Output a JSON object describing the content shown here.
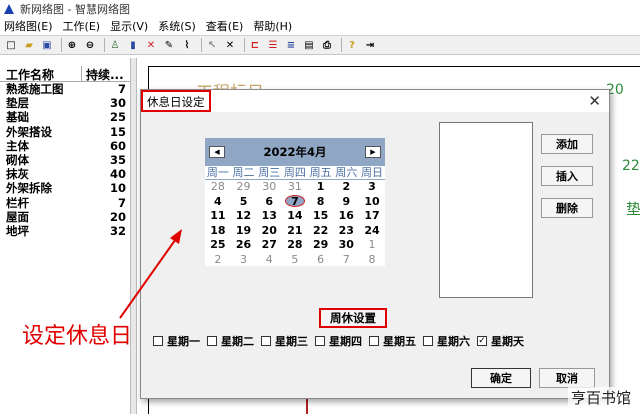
{
  "window": {
    "title": "新网络图 - 智慧网络图"
  },
  "menu": [
    "网络图(E)",
    "工作(E)",
    "显示(V)",
    "系统(S)",
    "查看(E)",
    "帮助(H)"
  ],
  "toolbar": {
    "icons": [
      "new-icon",
      "open-icon",
      "save-icon",
      "zoom-in-icon",
      "zoom-out-icon",
      "person-icon",
      "chart-icon",
      "delete-icon",
      "edit-icon",
      "link-icon",
      "cursor-icon",
      "tool-icon",
      "flow-icon",
      "bars-icon",
      "lines-icon",
      "preview-icon",
      "print-icon",
      "help-icon",
      "exit-icon"
    ]
  },
  "tasklist": {
    "col_name": "工作名称",
    "col_duration": "持续...",
    "rows": [
      {
        "name": "熟悉施工图",
        "duration": "7"
      },
      {
        "name": "垫层",
        "duration": "30"
      },
      {
        "name": "基础",
        "duration": "25"
      },
      {
        "name": "外架搭设",
        "duration": "15"
      },
      {
        "name": "主体",
        "duration": "60"
      },
      {
        "name": "砌体",
        "duration": "35"
      },
      {
        "name": "抹灰",
        "duration": "40"
      },
      {
        "name": "外架拆除",
        "duration": "10"
      },
      {
        "name": "栏杆",
        "duration": "7"
      },
      {
        "name": "屋面",
        "duration": "20"
      },
      {
        "name": "地坪",
        "duration": "32"
      }
    ]
  },
  "background": {
    "title_fragment": "工程标日",
    "number_top": "20",
    "number_mid": "22",
    "label_fragment": "垫"
  },
  "dialog": {
    "title": "休息日设定",
    "close_glyph": "✕",
    "calendar": {
      "month_label": "2022年4月",
      "weekdays": [
        "周一",
        "周二",
        "周三",
        "周四",
        "周五",
        "周六",
        "周日"
      ],
      "weeks": [
        [
          {
            "d": "28",
            "g": true
          },
          {
            "d": "29",
            "g": true
          },
          {
            "d": "30",
            "g": true
          },
          {
            "d": "31",
            "g": true
          },
          {
            "d": "1"
          },
          {
            "d": "2"
          },
          {
            "d": "3"
          }
        ],
        [
          {
            "d": "4"
          },
          {
            "d": "5"
          },
          {
            "d": "6"
          },
          {
            "d": "7",
            "sel": true
          },
          {
            "d": "8"
          },
          {
            "d": "9"
          },
          {
            "d": "10"
          }
        ],
        [
          {
            "d": "11"
          },
          {
            "d": "12"
          },
          {
            "d": "13"
          },
          {
            "d": "14"
          },
          {
            "d": "15"
          },
          {
            "d": "16"
          },
          {
            "d": "17"
          }
        ],
        [
          {
            "d": "18"
          },
          {
            "d": "19"
          },
          {
            "d": "20"
          },
          {
            "d": "21"
          },
          {
            "d": "22"
          },
          {
            "d": "23"
          },
          {
            "d": "24"
          }
        ],
        [
          {
            "d": "25"
          },
          {
            "d": "26"
          },
          {
            "d": "27"
          },
          {
            "d": "28"
          },
          {
            "d": "29"
          },
          {
            "d": "30"
          },
          {
            "d": "1",
            "g": true
          }
        ],
        [
          {
            "d": "2",
            "g": true
          },
          {
            "d": "3",
            "g": true
          },
          {
            "d": "4",
            "g": true
          },
          {
            "d": "5",
            "g": true
          },
          {
            "d": "6",
            "g": true
          },
          {
            "d": "7",
            "g": true
          },
          {
            "d": "8",
            "g": true
          }
        ]
      ]
    },
    "buttons": {
      "add": "添加",
      "insert": "插入",
      "delete": "删除",
      "ok": "确定",
      "cancel": "取消"
    },
    "weekend_title": "周休设置",
    "weekdays": [
      {
        "label": "星期一",
        "checked": false
      },
      {
        "label": "星期二",
        "checked": false
      },
      {
        "label": "星期三",
        "checked": false
      },
      {
        "label": "星期四",
        "checked": false
      },
      {
        "label": "星期五",
        "checked": false
      },
      {
        "label": "星期六",
        "checked": false
      },
      {
        "label": "星期天",
        "checked": true
      }
    ]
  },
  "annotation": {
    "text": "设定休息日",
    "color": "#e00000"
  },
  "watermark": "亨百书馆"
}
